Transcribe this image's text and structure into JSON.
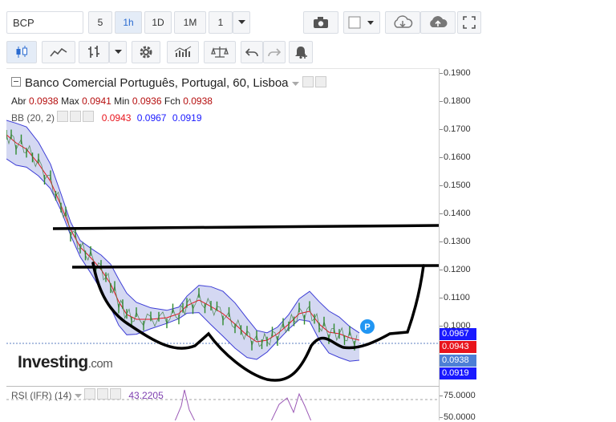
{
  "toolbar": {
    "symbol": "BCP",
    "intervals": [
      "5",
      "1h",
      "1D",
      "1M"
    ],
    "active_interval": "1h",
    "count": "1",
    "icons": [
      "camera-icon",
      "color-square-icon",
      "cloud-download-icon",
      "cloud-upload-icon",
      "fullscreen-icon"
    ],
    "tools": [
      "candles-icon",
      "area-chart-icon",
      "bars-icon",
      "gear-icon",
      "indicators-icon",
      "balance-icon",
      "undo-icon",
      "redo-icon",
      "alert-bell-icon"
    ]
  },
  "legend": {
    "title": "Banco Comercial Português, Portugal, 60, Lisboa",
    "abr_label": "Abr",
    "abr": "0.0938",
    "max_label": "Max",
    "max": "0.0941",
    "min_label": "Min",
    "min": "0.0936",
    "fch_label": "Fch",
    "fch": "0.0938",
    "bb_label": "BB (20, 2)",
    "bb_mid": "0.0943",
    "bb_upper": "0.0967",
    "bb_lower": "0.0919"
  },
  "price_axis": {
    "ticks": [
      "0.1900",
      "0.1800",
      "0.1700",
      "0.1600",
      "0.1500",
      "0.1400",
      "0.1300",
      "0.1200",
      "0.1100",
      "0.1000"
    ],
    "labels": [
      {
        "value": "0.0967",
        "color": "#1a1aff"
      },
      {
        "value": "0.0943",
        "color": "#e8141c"
      },
      {
        "value": "0.0938",
        "color": "#4d7fd6"
      },
      {
        "value": "0.0919",
        "color": "#1a1aff"
      }
    ],
    "rsi_tick": "75.0000",
    "rsi_tick2": "50.0000"
  },
  "rsi": {
    "label": "RSI (IFR) (14)",
    "value": "43.2205"
  },
  "logo": {
    "name": "Investing",
    "suffix": ".com"
  },
  "marker": "P",
  "colors": {
    "accent": "#2a6bd1",
    "bb_band": "#d4d8f2",
    "bb_line": "#3d3dd6",
    "mid_line": "#e8141c",
    "candle": "#2e8b2e"
  }
}
